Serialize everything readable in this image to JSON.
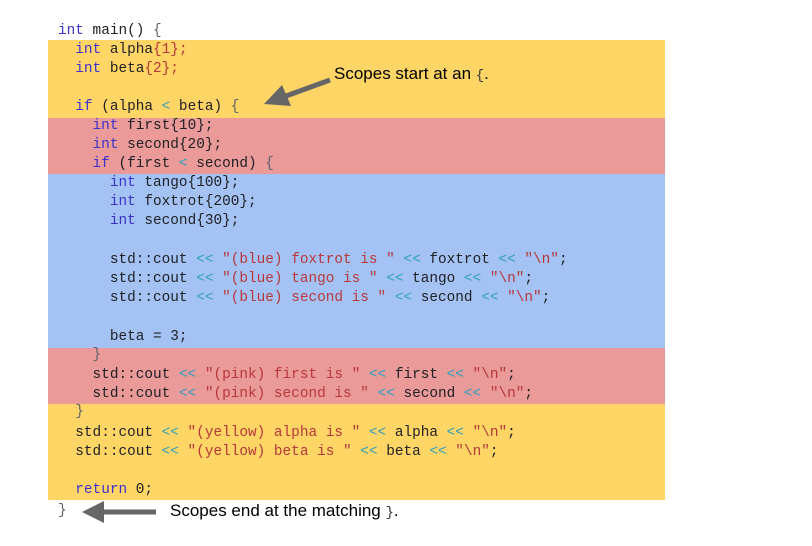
{
  "colors": {
    "outer_scope": "#ffd565",
    "middle_scope": "#e99a99",
    "inner_scope": "#a4c3f4",
    "keyword": "#3d32c8",
    "operator": "#2f9fbc",
    "string": "#b8383a",
    "arrow": "#666666"
  },
  "annotations": {
    "start_text": "Scopes start at an",
    "start_symbol": "{",
    "start_period": ".",
    "end_text": "Scopes end at the matching",
    "end_symbol": "}",
    "end_period": "."
  },
  "code": {
    "l1": {
      "a": "int",
      "b": " main() ",
      "c": "{"
    },
    "l2": {
      "indent": "  ",
      "a": "int",
      "b": " alpha",
      "c": "{1};"
    },
    "l3": {
      "indent": "  ",
      "a": "int",
      "b": " beta",
      "c": "{2};"
    },
    "l5": {
      "indent": "  ",
      "a": "if",
      "b": " (alpha ",
      "op": "<",
      "d": " beta) ",
      "e": "{"
    },
    "l6": {
      "indent": "    ",
      "a": "int",
      "b": " first",
      "c": "{10};"
    },
    "l7": {
      "indent": "    ",
      "a": "int",
      "b": " second",
      "c": "{20};"
    },
    "l8": {
      "indent": "    ",
      "a": "if",
      "b": " (first ",
      "op": "<",
      "d": " second) ",
      "e": "{"
    },
    "l9": {
      "indent": "      ",
      "a": "int",
      "b": " tango",
      "c": "{100};"
    },
    "l10": {
      "indent": "      ",
      "a": "int",
      "b": " foxtrot",
      "c": "{200};"
    },
    "l11": {
      "indent": "      ",
      "a": "int",
      "b": " second",
      "c": "{30};"
    },
    "l13": {
      "indent": "      ",
      "a": "std::cout ",
      "op1": "<<",
      "s1": " \"(blue) foxtrot is \" ",
      "op2": "<<",
      "v": " foxtrot ",
      "op3": "<<",
      "s2": " \"\\n\"",
      "end": ";"
    },
    "l14": {
      "indent": "      ",
      "a": "std::cout ",
      "op1": "<<",
      "s1": " \"(blue) tango is \" ",
      "op2": "<<",
      "v": " tango ",
      "op3": "<<",
      "s2": " \"\\n\"",
      "end": ";"
    },
    "l15": {
      "indent": "      ",
      "a": "std::cout ",
      "op1": "<<",
      "s1": " \"(blue) second is \" ",
      "op2": "<<",
      "v": " second ",
      "op3": "<<",
      "s2": " \"\\n\"",
      "end": ";"
    },
    "l17": {
      "indent": "      ",
      "a": "beta = 3;"
    },
    "l18": {
      "indent": "    ",
      "a": "}"
    },
    "l19": {
      "indent": "    ",
      "a": "std::cout ",
      "op1": "<<",
      "s1": " \"(pink) first is \" ",
      "op2": "<<",
      "v": " first ",
      "op3": "<<",
      "s2": " \"\\n\"",
      "end": ";"
    },
    "l20": {
      "indent": "    ",
      "a": "std::cout ",
      "op1": "<<",
      "s1": " \"(pink) second is \" ",
      "op2": "<<",
      "v": " second ",
      "op3": "<<",
      "s2": " \"\\n\"",
      "end": ";"
    },
    "l21": {
      "indent": "  ",
      "a": "}"
    },
    "l22": {
      "indent": "  ",
      "a": "std::cout ",
      "op1": "<<",
      "s1": " \"(yellow) alpha is \" ",
      "op2": "<<",
      "v": " alpha ",
      "op3": "<<",
      "s2": " \"\\n\"",
      "end": ";"
    },
    "l23": {
      "indent": "  ",
      "a": "std::cout ",
      "op1": "<<",
      "s1": " \"(yellow) beta is \" ",
      "op2": "<<",
      "v": " beta ",
      "op3": "<<",
      "s2": " \"\\n\"",
      "end": ";"
    },
    "l25": {
      "indent": "  ",
      "a": "return",
      "b": " 0;"
    },
    "l26": {
      "a": "}"
    }
  }
}
